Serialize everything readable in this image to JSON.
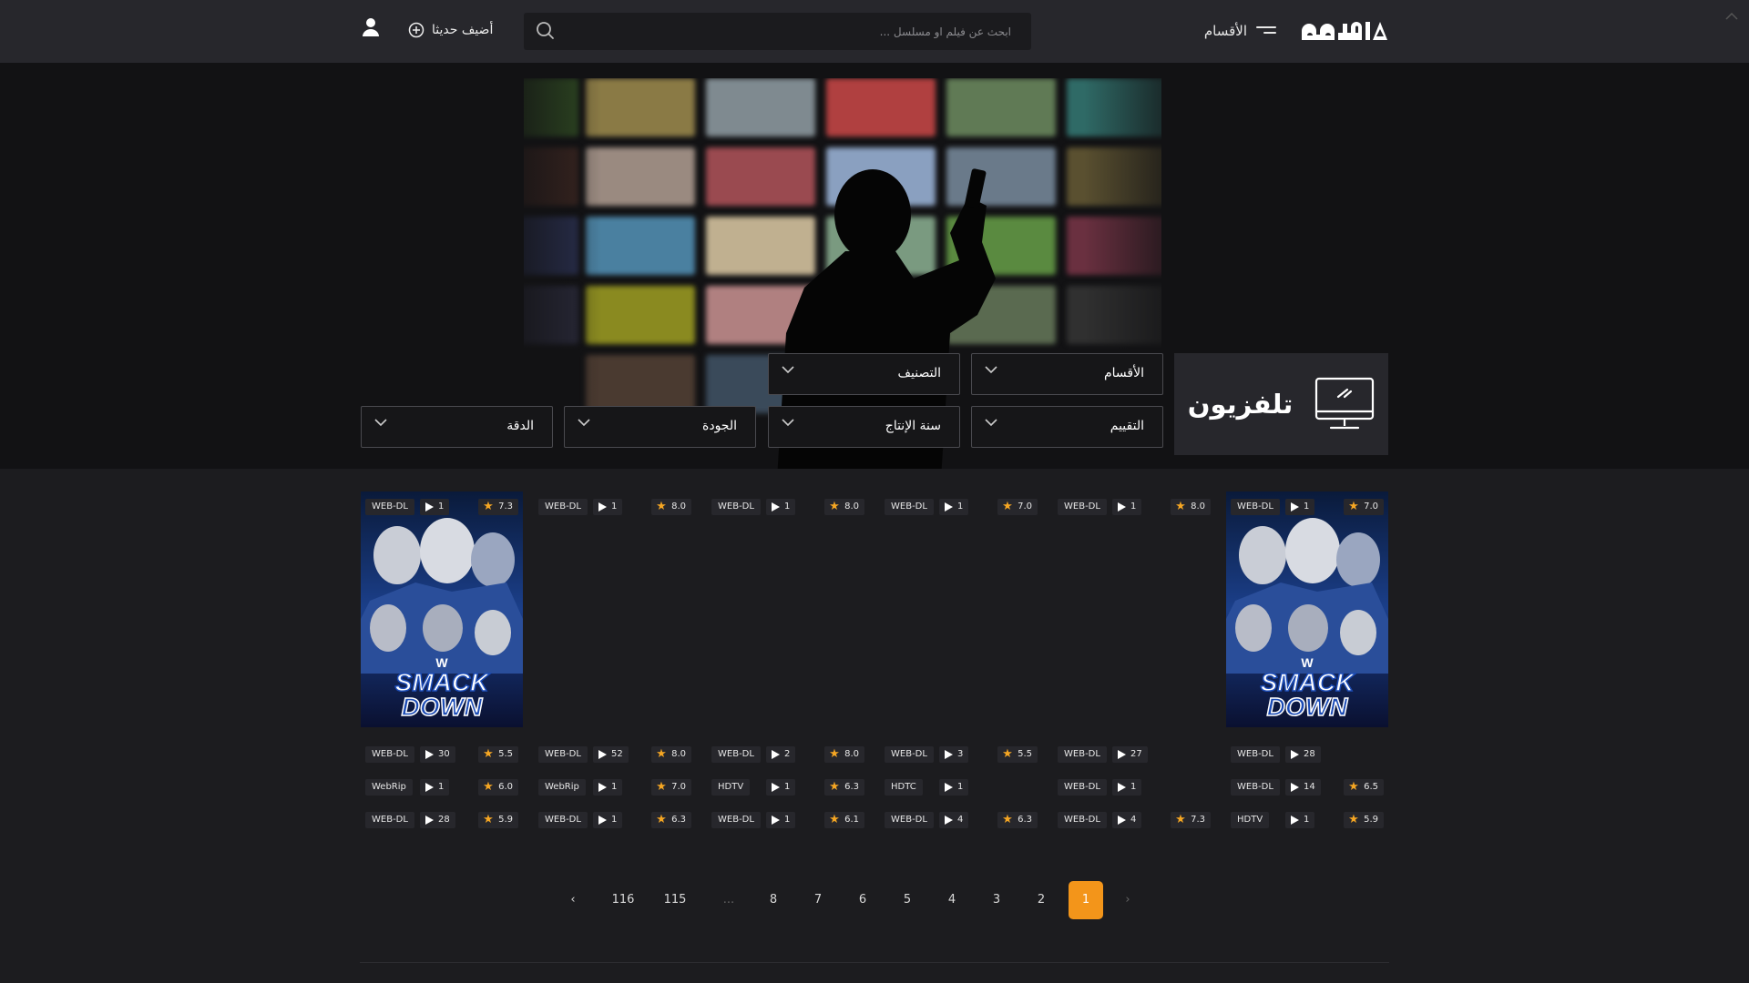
{
  "header": {
    "brand": "اكوام",
    "categories_label": "الأقسام",
    "search_placeholder": "ابحث عن فيلم او مسلسل ...",
    "add_new_label": "أضيف حديثا"
  },
  "page": {
    "title": "تلفزيون",
    "filters": {
      "categories": "الأقسام",
      "classification": "التصنيف",
      "rating": "التقييم",
      "year": "سنة الإنتاج",
      "quality": "الجودة",
      "resolution": "الدقة"
    }
  },
  "rows": [
    [
      {
        "quality": "WEB-DL",
        "episodes": "1",
        "rating": "7.0",
        "poster": "smackdown"
      },
      {
        "quality": "WEB-DL",
        "episodes": "1",
        "rating": "8.0",
        "poster": ""
      },
      {
        "quality": "WEB-DL",
        "episodes": "1",
        "rating": "7.0",
        "poster": ""
      },
      {
        "quality": "WEB-DL",
        "episodes": "1",
        "rating": "8.0",
        "poster": ""
      },
      {
        "quality": "WEB-DL",
        "episodes": "1",
        "rating": "8.0",
        "poster": ""
      },
      {
        "quality": "WEB-DL",
        "episodes": "1",
        "rating": "7.3",
        "poster": "smackdown"
      }
    ],
    [
      {
        "quality": "WEB-DL",
        "episodes": "28",
        "rating": ""
      },
      {
        "quality": "WEB-DL",
        "episodes": "27",
        "rating": ""
      },
      {
        "quality": "WEB-DL",
        "episodes": "3",
        "rating": "5.5"
      },
      {
        "quality": "WEB-DL",
        "episodes": "2",
        "rating": "8.0"
      },
      {
        "quality": "WEB-DL",
        "episodes": "52",
        "rating": "8.0"
      },
      {
        "quality": "WEB-DL",
        "episodes": "30",
        "rating": "5.5"
      }
    ],
    [
      {
        "quality": "WEB-DL",
        "episodes": "14",
        "rating": "6.5"
      },
      {
        "quality": "WEB-DL",
        "episodes": "1",
        "rating": ""
      },
      {
        "quality": "HDTC",
        "episodes": "1",
        "rating": ""
      },
      {
        "quality": "HDTV",
        "episodes": "1",
        "rating": "6.3"
      },
      {
        "quality": "WebRip",
        "episodes": "1",
        "rating": "7.0"
      },
      {
        "quality": "WebRip",
        "episodes": "1",
        "rating": "6.0"
      }
    ],
    [
      {
        "quality": "HDTV",
        "episodes": "1",
        "rating": "5.9"
      },
      {
        "quality": "WEB-DL",
        "episodes": "4",
        "rating": "7.3"
      },
      {
        "quality": "WEB-DL",
        "episodes": "4",
        "rating": "6.3"
      },
      {
        "quality": "WEB-DL",
        "episodes": "1",
        "rating": "6.1"
      },
      {
        "quality": "WEB-DL",
        "episodes": "1",
        "rating": "6.3"
      },
      {
        "quality": "WEB-DL",
        "episodes": "28",
        "rating": "5.9"
      }
    ]
  ],
  "pagination": {
    "next": "›",
    "pages": [
      "1",
      "2",
      "3",
      "4",
      "5",
      "6",
      "7",
      "8"
    ],
    "ellipsis": "...",
    "tail": [
      "115",
      "116"
    ],
    "prev": "‹",
    "current": "1"
  },
  "colors": {
    "accent": "#f3951a",
    "star": "#f5a623",
    "header_bg": "#27272c",
    "page_bg": "#1c1c1f"
  }
}
